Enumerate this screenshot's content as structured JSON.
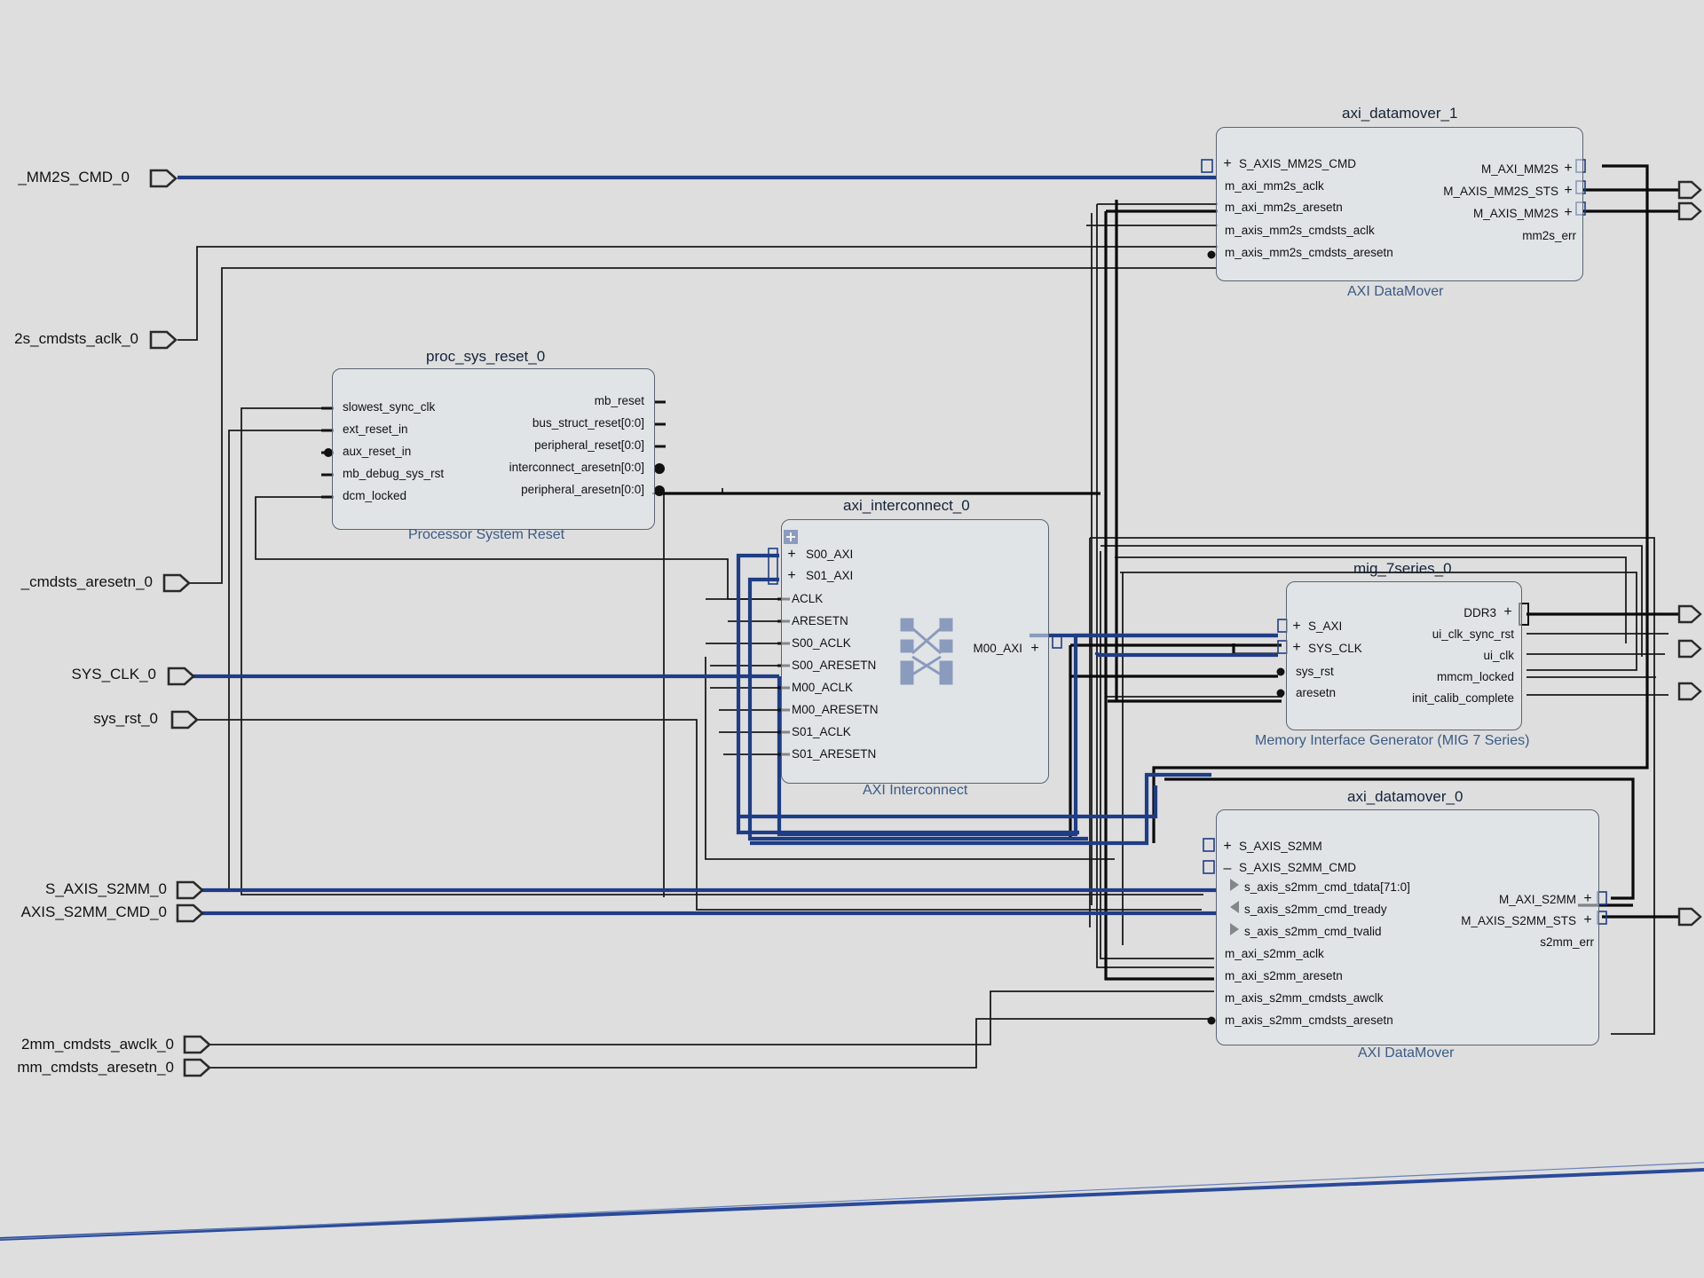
{
  "ports_left": [
    "_MM2S_CMD_0",
    "2s_cmdsts_aclk_0",
    "_cmdsts_aresetn_0",
    "SYS_CLK_0",
    "sys_rst_0",
    "S_AXIS_S2MM_0",
    "AXIS_S2MM_CMD_0",
    "2mm_cmdsts_awclk_0",
    "mm_cmdsts_aresetn_0"
  ],
  "proc_sys_reset": {
    "name": "proc_sys_reset_0",
    "type": "Processor System Reset",
    "inputs": [
      "slowest_sync_clk",
      "ext_reset_in",
      "aux_reset_in",
      "mb_debug_sys_rst",
      "dcm_locked"
    ],
    "outputs": [
      "mb_reset",
      "bus_struct_reset[0:0]",
      "peripheral_reset[0:0]",
      "interconnect_aresetn[0:0]",
      "peripheral_aresetn[0:0]"
    ]
  },
  "axi_interconnect": {
    "name": "axi_interconnect_0",
    "type": "AXI Interconnect",
    "inputs": [
      "S00_AXI",
      "S01_AXI",
      "ACLK",
      "ARESETN",
      "S00_ACLK",
      "S00_ARESETN",
      "M00_ACLK",
      "M00_ARESETN",
      "S01_ACLK",
      "S01_ARESETN"
    ],
    "output": "M00_AXI"
  },
  "datamover_1": {
    "name": "axi_datamover_1",
    "type": "AXI DataMover",
    "inputs": [
      "S_AXIS_MM2S_CMD",
      "m_axi_mm2s_aclk",
      "m_axi_mm2s_aresetn",
      "m_axis_mm2s_cmdsts_aclk",
      "m_axis_mm2s_cmdsts_aresetn"
    ],
    "outputs": [
      "M_AXI_MM2S",
      "M_AXIS_MM2S_STS",
      "M_AXIS_MM2S",
      "mm2s_err"
    ]
  },
  "mig": {
    "name": "mig_7series_0",
    "type": "Memory Interface Generator (MIG 7 Series)",
    "inputs": [
      "S_AXI",
      "SYS_CLK",
      "sys_rst",
      "aresetn"
    ],
    "outputs": [
      "DDR3",
      "ui_clk_sync_rst",
      "ui_clk",
      "mmcm_locked",
      "init_calib_complete"
    ]
  },
  "datamover_0": {
    "name": "axi_datamover_0",
    "type": "AXI DataMover",
    "inputs": [
      "S_AXIS_S2MM",
      "S_AXIS_S2MM_CMD",
      "s_axis_s2mm_cmd_tdata[71:0]",
      "s_axis_s2mm_cmd_tready",
      "s_axis_s2mm_cmd_tvalid",
      "m_axi_s2mm_aclk",
      "m_axi_s2mm_aresetn",
      "m_axis_s2mm_cmdsts_awclk",
      "m_axis_s2mm_cmdsts_aresetn"
    ],
    "outputs": [
      "M_AXI_S2MM",
      "M_AXIS_S2MM_STS",
      "s2mm_err"
    ]
  },
  "colors": {
    "bus": "#1f3d86",
    "wire": "#1a1a1a",
    "label_blue": "#3a5a86"
  }
}
